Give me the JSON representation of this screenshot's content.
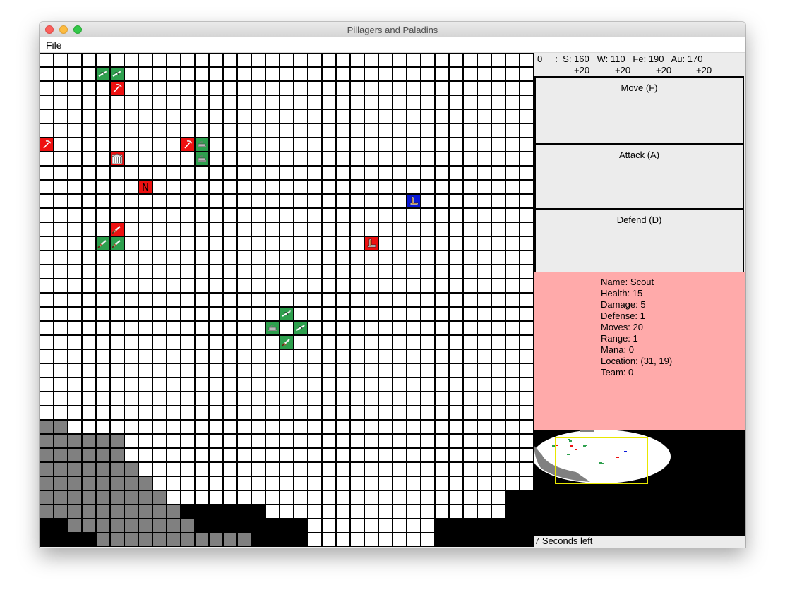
{
  "window": {
    "title": "Pillagers and Paladins"
  },
  "menu": {
    "file_label": "File"
  },
  "resources": {
    "player": "0",
    "sep": ":",
    "stone": "S: 160",
    "wood": "W: 110",
    "iron": "Fe: 190",
    "gold": "Au: 170",
    "stone_inc": "+20",
    "wood_inc": "+20",
    "iron_inc": "+20",
    "gold_inc": "+20"
  },
  "actions": {
    "move_label": "Move (F)",
    "attack_label": "Attack (A)",
    "defend_label": "Defend (D)"
  },
  "unit_info": {
    "name": "Name: Scout",
    "health": "Health: 15",
    "damage": "Damage: 5",
    "defense": "Defense: 1",
    "moves": "Moves: 20",
    "range": "Range: 1",
    "mana": "Mana: 0",
    "location": "Location: (31, 19)",
    "team": "Team: 0"
  },
  "status": {
    "timer_text": "7 Seconds left"
  },
  "colors": {
    "team_green": "#2ea04e",
    "team_red": "#ee1111",
    "team_blue": "#0a18d8",
    "mountain": "#808080",
    "void": "#000000",
    "panel_pink": "#ffaaaa",
    "viewport_outline": "#e8e800"
  },
  "board": {
    "columns": 35,
    "rows": 35,
    "land_rows": [
      [
        0,
        34
      ],
      [
        0,
        34
      ],
      [
        0,
        34
      ],
      [
        0,
        34
      ],
      [
        0,
        34
      ],
      [
        0,
        34
      ],
      [
        0,
        34
      ],
      [
        0,
        34
      ],
      [
        0,
        34
      ],
      [
        0,
        34
      ],
      [
        0,
        34
      ],
      [
        0,
        34
      ],
      [
        0,
        34
      ],
      [
        0,
        34
      ],
      [
        0,
        34
      ],
      [
        0,
        34
      ],
      [
        0,
        34
      ],
      [
        0,
        34
      ],
      [
        0,
        34
      ],
      [
        0,
        34
      ],
      [
        0,
        34
      ],
      [
        0,
        34
      ],
      [
        0,
        34
      ],
      [
        0,
        34
      ],
      [
        0,
        34
      ],
      [
        0,
        34
      ],
      [
        0,
        34
      ],
      [
        0,
        34
      ],
      [
        0,
        34
      ],
      [
        0,
        34
      ],
      [
        0,
        34
      ],
      [
        7,
        32
      ],
      [
        16,
        32
      ],
      [
        19,
        27
      ],
      [
        19,
        27
      ]
    ],
    "mountains": [
      [
        26,
        0
      ],
      [
        26,
        1
      ],
      [
        27,
        0
      ],
      [
        27,
        1
      ],
      [
        27,
        2
      ],
      [
        27,
        3
      ],
      [
        27,
        4
      ],
      [
        27,
        5
      ],
      [
        28,
        0
      ],
      [
        28,
        1
      ],
      [
        28,
        2
      ],
      [
        28,
        3
      ],
      [
        28,
        4
      ],
      [
        28,
        5
      ],
      [
        29,
        0
      ],
      [
        29,
        1
      ],
      [
        29,
        2
      ],
      [
        29,
        3
      ],
      [
        29,
        4
      ],
      [
        29,
        5
      ],
      [
        29,
        6
      ],
      [
        30,
        0
      ],
      [
        30,
        1
      ],
      [
        30,
        2
      ],
      [
        30,
        3
      ],
      [
        30,
        4
      ],
      [
        30,
        5
      ],
      [
        30,
        6
      ],
      [
        30,
        7
      ],
      [
        31,
        0
      ],
      [
        31,
        1
      ],
      [
        31,
        2
      ],
      [
        31,
        3
      ],
      [
        31,
        4
      ],
      [
        31,
        5
      ],
      [
        31,
        6
      ],
      [
        31,
        7
      ],
      [
        31,
        8
      ],
      [
        32,
        0
      ],
      [
        32,
        1
      ],
      [
        32,
        2
      ],
      [
        32,
        3
      ],
      [
        32,
        4
      ],
      [
        32,
        5
      ],
      [
        32,
        6
      ],
      [
        32,
        7
      ],
      [
        32,
        8
      ],
      [
        32,
        9
      ],
      [
        33,
        2
      ],
      [
        33,
        3
      ],
      [
        33,
        4
      ],
      [
        33,
        5
      ],
      [
        33,
        6
      ],
      [
        33,
        7
      ],
      [
        33,
        8
      ],
      [
        33,
        9
      ],
      [
        33,
        10
      ],
      [
        34,
        4
      ],
      [
        34,
        5
      ],
      [
        34,
        6
      ],
      [
        34,
        7
      ],
      [
        34,
        8
      ],
      [
        34,
        9
      ],
      [
        34,
        10
      ],
      [
        34,
        11
      ],
      [
        34,
        12
      ],
      [
        34,
        13
      ],
      [
        34,
        14
      ]
    ],
    "units": [
      {
        "row": 1,
        "col": 4,
        "team": "green",
        "icon": "bow"
      },
      {
        "row": 1,
        "col": 5,
        "team": "green",
        "icon": "bow"
      },
      {
        "row": 2,
        "col": 5,
        "team": "red",
        "icon": "pickaxe"
      },
      {
        "row": 6,
        "col": 0,
        "team": "red",
        "icon": "pickaxe"
      },
      {
        "row": 6,
        "col": 10,
        "team": "red",
        "icon": "pickaxe"
      },
      {
        "row": 6,
        "col": 11,
        "team": "green",
        "icon": "cannon"
      },
      {
        "row": 7,
        "col": 5,
        "team": "red",
        "icon": "building"
      },
      {
        "row": 7,
        "col": 11,
        "team": "green",
        "icon": "cannon"
      },
      {
        "row": 9,
        "col": 7,
        "team": "red",
        "icon": "N"
      },
      {
        "row": 10,
        "col": 26,
        "team": "blue",
        "icon": "boot"
      },
      {
        "row": 12,
        "col": 5,
        "team": "red",
        "icon": "sword"
      },
      {
        "row": 13,
        "col": 4,
        "team": "green",
        "icon": "sword"
      },
      {
        "row": 13,
        "col": 5,
        "team": "green",
        "icon": "sword"
      },
      {
        "row": 13,
        "col": 23,
        "team": "red",
        "icon": "boot"
      },
      {
        "row": 18,
        "col": 17,
        "team": "green",
        "icon": "bow"
      },
      {
        "row": 19,
        "col": 16,
        "team": "green",
        "icon": "cannon"
      },
      {
        "row": 19,
        "col": 18,
        "team": "green",
        "icon": "bow"
      },
      {
        "row": 20,
        "col": 17,
        "team": "green",
        "icon": "sword"
      }
    ]
  }
}
